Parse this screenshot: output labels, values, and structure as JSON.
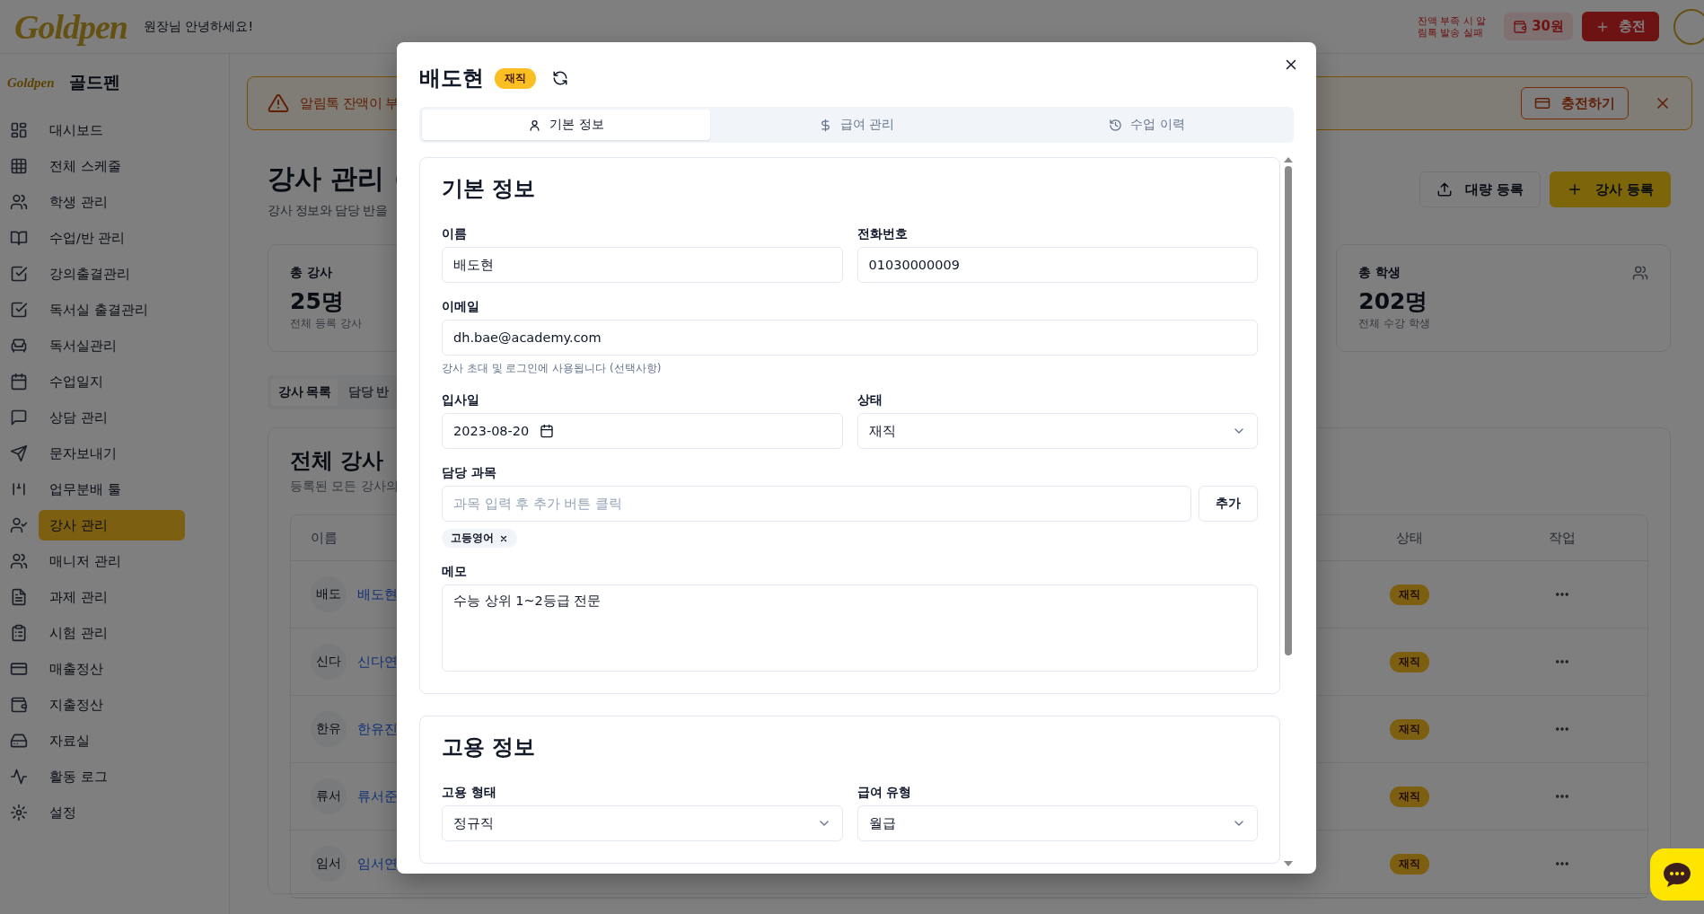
{
  "header": {
    "logo": "Goldpen",
    "greeting": "원장님 안녕하세요!",
    "notice": "잔액 부족 시 알림톡 발송 실패",
    "balance": "30원",
    "charge_button": "충전"
  },
  "sidebar": {
    "logo": "Goldpen",
    "brand": "골드펜",
    "items": [
      {
        "label": "대시보드",
        "selected": false
      },
      {
        "label": "전체 스케줄",
        "selected": false
      },
      {
        "label": "학생 관리",
        "selected": false
      },
      {
        "label": "수업/반 관리",
        "selected": false
      },
      {
        "label": "강의출결관리",
        "selected": false
      },
      {
        "label": "독서실 출결관리",
        "selected": false
      },
      {
        "label": "독서실관리",
        "selected": false
      },
      {
        "label": "수업일지",
        "selected": false
      },
      {
        "label": "상담 관리",
        "selected": false
      },
      {
        "label": "문자보내기",
        "selected": false
      },
      {
        "label": "업무분배 툴",
        "selected": false
      },
      {
        "label": "강사 관리",
        "selected": true
      },
      {
        "label": "매니저 관리",
        "selected": false
      },
      {
        "label": "과제 관리",
        "selected": false
      },
      {
        "label": "시험 관리",
        "selected": false
      },
      {
        "label": "매출정산",
        "selected": false
      },
      {
        "label": "지출정산",
        "selected": false
      },
      {
        "label": "자료실",
        "selected": false
      },
      {
        "label": "활동 로그",
        "selected": false
      },
      {
        "label": "설정",
        "selected": false
      }
    ]
  },
  "alert": {
    "message": "알림톡 잔액이 부",
    "button": "충전하기"
  },
  "page": {
    "title": "강사 관리",
    "subtitle": "강사 정보와 담당 반을",
    "buttons": [
      {
        "label": "대량 등록",
        "kind": "outline"
      },
      {
        "label": "강사 등록",
        "kind": "primary"
      }
    ]
  },
  "stats": [
    {
      "label": "총 강사",
      "value": "25명",
      "caption": "전체 등록 강사"
    },
    {
      "label": "총 학생",
      "value": "202명",
      "caption": "전체 수강 학생"
    }
  ],
  "tabs": [
    {
      "label": "강사 목록",
      "selected": true
    },
    {
      "label": "담당 반",
      "selected": false
    }
  ],
  "list": {
    "title": "전체 강사",
    "subtitle": "등록된 모든 강사의",
    "columns": [
      "이름",
      "상태",
      "작업"
    ],
    "rows": [
      {
        "initials": "배도",
        "name": "배도현",
        "status": "재직"
      },
      {
        "initials": "신다",
        "name": "신다연",
        "status": "재직"
      },
      {
        "initials": "한유",
        "name": "한유진",
        "status": "재직"
      },
      {
        "initials": "류서",
        "name": "류서준",
        "status": "재직"
      },
      {
        "initials": "임서",
        "name": "임서연",
        "status": "재직"
      }
    ]
  },
  "modal": {
    "title": "배도현",
    "status": "재직",
    "tabs": [
      {
        "label": "기본 정보",
        "selected": true
      },
      {
        "label": "급여 관리",
        "selected": false
      },
      {
        "label": "수업 이력",
        "selected": false
      }
    ],
    "sections": [
      {
        "title": "기본 정보",
        "rows": [
          [
            {
              "kind": "text",
              "label": "이름",
              "value": "배도현"
            },
            {
              "kind": "text",
              "label": "전화번호",
              "value": "01030000009"
            }
          ],
          [
            {
              "kind": "text",
              "label": "이메일",
              "value": "dh.bae@academy.com",
              "help": "강사 초대 및 로그인에 사용됩니다 (선택사항)"
            }
          ],
          [
            {
              "kind": "date",
              "label": "입사일",
              "value": "2023-08-20"
            },
            {
              "kind": "select",
              "label": "상태",
              "value": "재직"
            }
          ],
          [
            {
              "kind": "tags",
              "label": "담당 과목",
              "placeholder": "과목 입력 후 추가 버튼 클릭",
              "button": "추가",
              "tags": [
                "고등영어"
              ]
            }
          ],
          [
            {
              "kind": "textarea",
              "label": "메모",
              "value": "수능 상위 1~2등급 전문"
            }
          ]
        ]
      },
      {
        "title": "고용 정보",
        "rows": [
          [
            {
              "kind": "select",
              "label": "고용 형태",
              "value": "정규직"
            },
            {
              "kind": "select",
              "label": "급여 유형",
              "value": "월급"
            }
          ]
        ]
      }
    ]
  }
}
